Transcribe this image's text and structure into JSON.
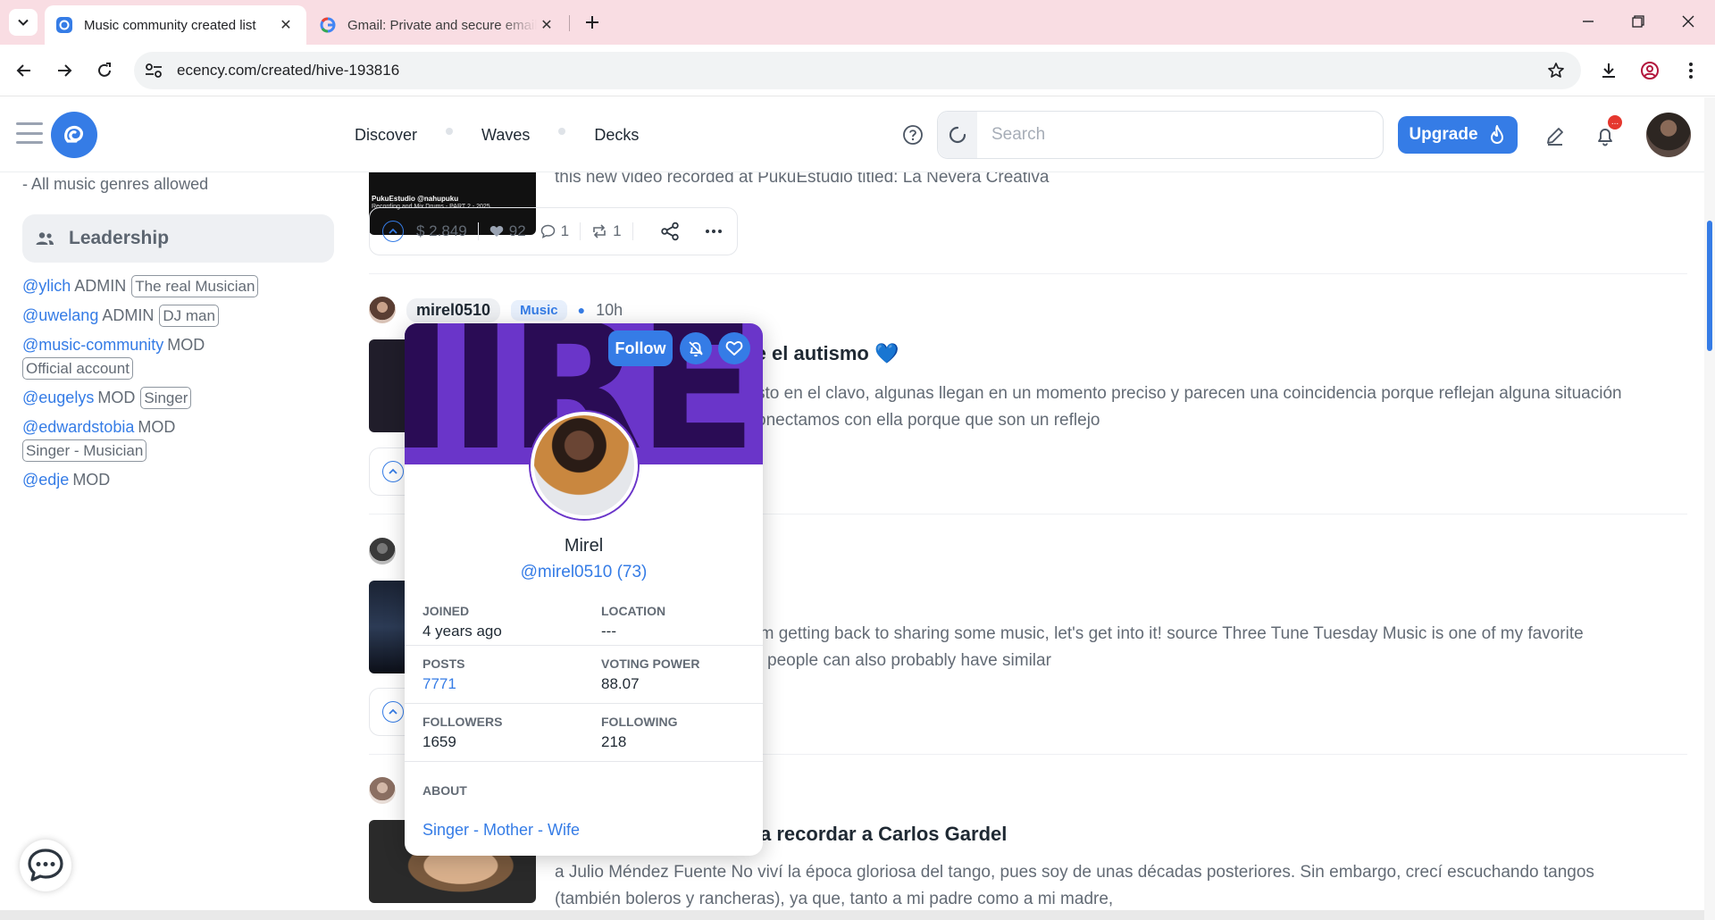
{
  "browser": {
    "tabs": [
      {
        "title": "Music community created list",
        "active": true
      },
      {
        "title": "Gmail: Private and secure email",
        "active": false
      }
    ],
    "url": "ecency.com/created/hive-193816"
  },
  "header": {
    "nav": [
      "Discover",
      "Waves",
      "Decks"
    ],
    "search_placeholder": "Search",
    "upgrade_label": "Upgrade",
    "notification_badge": "...",
    "accent_color": "#357ce6"
  },
  "sidebar": {
    "rules_tail": "- All music genres allowed",
    "leadership_title": "Leadership",
    "leaders": [
      {
        "user": "@ylich",
        "role": "ADMIN",
        "title": "The real Musician"
      },
      {
        "user": "@uwelang",
        "role": "ADMIN",
        "title": "DJ man"
      },
      {
        "user": "@music-community",
        "role": "MOD",
        "title": "Official account"
      },
      {
        "user": "@eugelys",
        "role": "MOD",
        "title": "Singer"
      },
      {
        "user": "@edwardstobia",
        "role": "MOD",
        "title": "Singer - Musician"
      },
      {
        "user": "@edje",
        "role": "MOD",
        "title": ""
      }
    ]
  },
  "feed": {
    "post1": {
      "thumb_caption_1": "PukuEstudio @nahupuku",
      "thumb_caption_2": "Recording and Mix Drums - PART 2 - 2025",
      "summary": "this new video recorded at PukuEstudio titled: La Nevera Creativa",
      "payout": "$ 2.849",
      "votes": "92",
      "comments": "1",
      "reblogs": "1"
    },
    "post2": {
      "author": "mirel0510",
      "category": "Music",
      "age": "10h",
      "title_visible": "anción sobre el autismo",
      "title_emoji": "💙",
      "summary_line1": "sto en el clavo, algunas llegan en un momento preciso y parecen una coincidencia porque reflejan alguna situación",
      "summary_line2": "onectamos con ella porque que son un reflejo"
    },
    "post3": {
      "summary_line1": "'m getting back to sharing some music, let's get into it! source Three Tune Tuesday Music is one of my favorite",
      "summary_line2": "people can also probably have similar"
    },
    "post4": {
      "title_visible": "a recordar a Carlos Gardel",
      "summary_line1": "a Julio Méndez Fuente No viví la época gloriosa del tango, pues soy de unas décadas posteriores. Sin embargo, crecí escuchando tangos",
      "summary_line2": "(también boleros y rancheras), ya que, tanto a mi padre como a mi madre,"
    }
  },
  "profile_card": {
    "cover_text": "IIREI",
    "follow_label": "Follow",
    "name": "Mirel",
    "handle": "@mirel0510 (73)",
    "joined_label": "JOINED",
    "joined_value": "4 years ago",
    "location_label": "LOCATION",
    "location_value": "---",
    "posts_label": "POSTS",
    "posts_value": "7771",
    "vp_label": "VOTING POWER",
    "vp_value": "88.07",
    "followers_label": "FOLLOWERS",
    "followers_value": "1659",
    "following_label": "FOLLOWING",
    "following_value": "218",
    "about_label": "ABOUT",
    "about_value": "Singer - Mother - Wife"
  }
}
